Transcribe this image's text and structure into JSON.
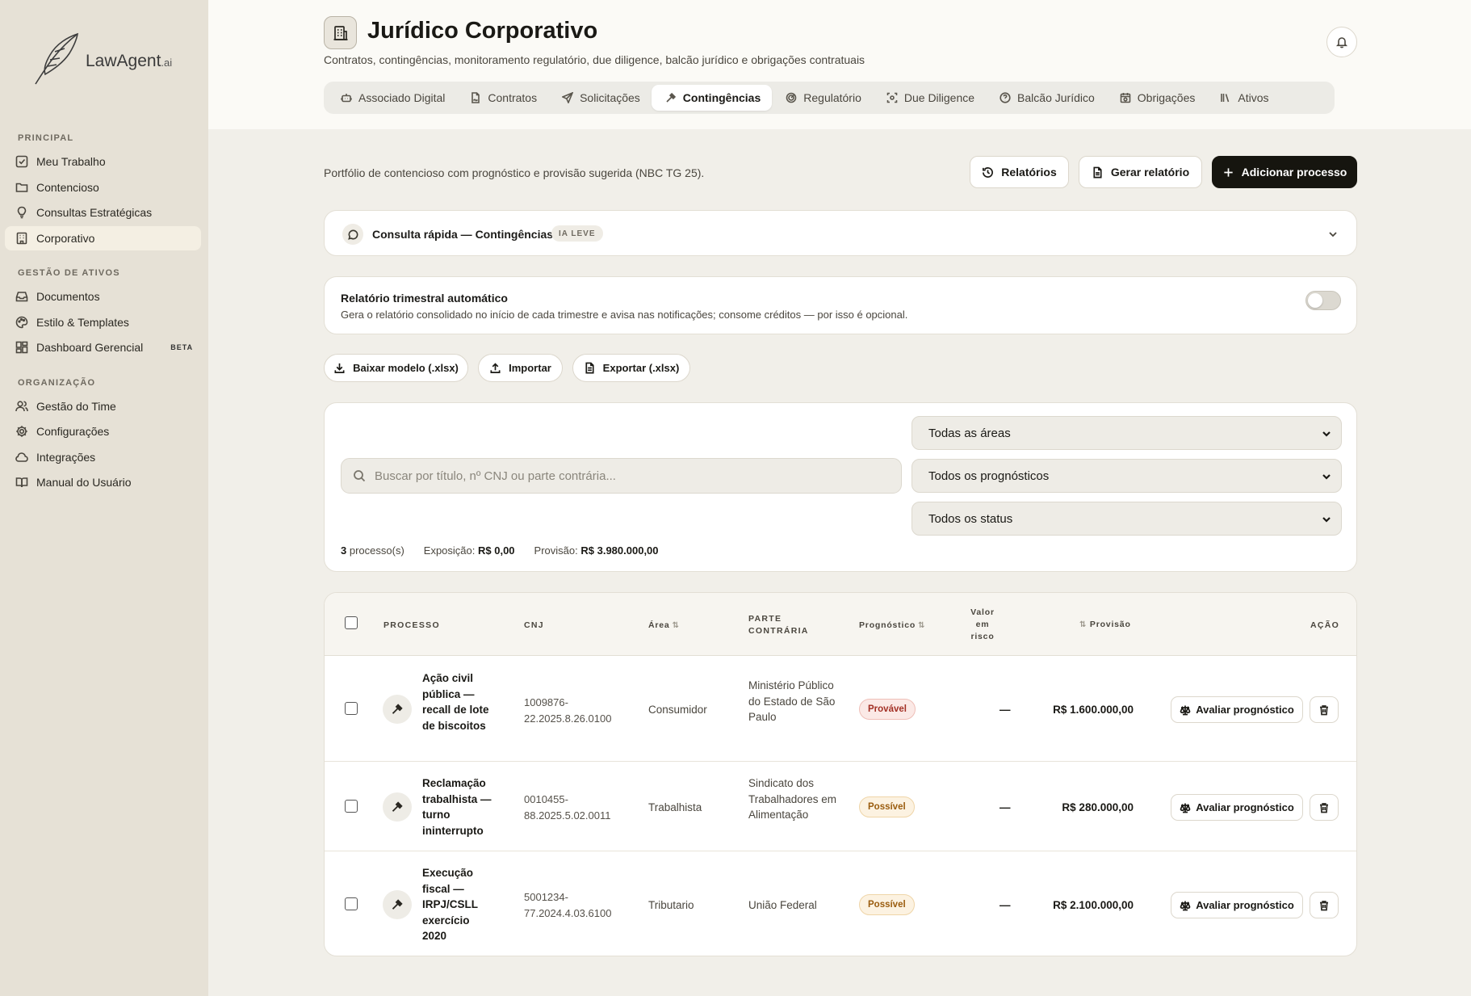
{
  "app": {
    "logo_text": "LawAgent",
    "logo_suffix": ".ai"
  },
  "sidebar": {
    "sections": [
      {
        "title": "PRINCIPAL",
        "items": [
          "Meu Trabalho",
          "Contencioso",
          "Consultas Estratégicas",
          "Corporativo"
        ]
      },
      {
        "title": "GESTÃO DE ATIVOS",
        "items": [
          "Documentos",
          "Estilo & Templates",
          "Dashboard Gerencial"
        ]
      },
      {
        "title": "ORGANIZAÇÃO",
        "items": [
          "Gestão do Time",
          "Configurações",
          "Integrações",
          "Manual do Usuário"
        ]
      }
    ],
    "beta_badge": "BETA",
    "active_item": "Corporativo"
  },
  "header": {
    "title": "Jurídico Corporativo",
    "subtitle": "Contratos, contingências, monitoramento regulatório, due diligence, balcão jurídico e obrigações contratuais",
    "tabs": [
      {
        "label": "Associado Digital",
        "icon": "robot-icon"
      },
      {
        "label": "Contratos",
        "icon": "file-signature-icon"
      },
      {
        "label": "Solicitações",
        "icon": "send-icon"
      },
      {
        "label": "Contingências",
        "icon": "gavel-icon",
        "active": true
      },
      {
        "label": "Regulatório",
        "icon": "radar-icon"
      },
      {
        "label": "Due Diligence",
        "icon": "scan-icon"
      },
      {
        "label": "Balcão Jurídico",
        "icon": "help-circle-icon"
      },
      {
        "label": "Obrigações",
        "icon": "calendar-clock-icon"
      },
      {
        "label": "Ativos",
        "icon": "library-icon"
      }
    ]
  },
  "main": {
    "description": "Portfólio de contencioso com prognóstico e provisão sugerida (NBC TG 25).",
    "buttons": {
      "relatorios": "Relatórios",
      "gerar_relatorio": "Gerar relatório",
      "adicionar_processo": "Adicionar processo"
    },
    "consulta": {
      "title": "Consulta rápida — Contingências",
      "badge": "IA LEVE"
    },
    "relatorio_auto": {
      "title": "Relatório trimestral automático",
      "description": "Gera o relatório consolidado no início de cada trimestre e avisa nas notificações; consome créditos — por isso é opcional.",
      "enabled": false
    },
    "io_buttons": {
      "baixar": "Baixar modelo (.xlsx)",
      "importar": "Importar",
      "exportar": "Exportar (.xlsx)"
    },
    "filters": {
      "search_placeholder": "Buscar por título, nº CNJ ou parte contrária...",
      "area": "Todas as áreas",
      "prognostico": "Todos os prognósticos",
      "status": "Todos os status"
    },
    "summary": {
      "count": "3",
      "count_label": "processo(s)",
      "exposicao_label": "Exposição:",
      "exposicao": "R$ 0,00",
      "provisao_label": "Provisão:",
      "provisao": "R$ 3.980.000,00"
    }
  },
  "table": {
    "headers": {
      "processo": "PROCESSO",
      "cnj": "CNJ",
      "area": "Área",
      "parte": "PARTE CONTRÁRIA",
      "prognostico": "Prognóstico",
      "valor_em_risco": "Valor em risco",
      "provisao": "Provisão",
      "acao": "AÇÃO"
    },
    "action_label": "Avaliar prognóstico",
    "rows": [
      {
        "title": "Ação civil pública — recall de lote de biscoitos",
        "cnj": "1009876-22.2025.8.26.0100",
        "area": "Consumidor",
        "parte": "Ministério Público do Estado de São Paulo",
        "prognostico": "Provável",
        "valor": "—",
        "provisao": "R$ 1.600.000,00"
      },
      {
        "title": "Reclamação trabalhista — turno ininterrupto",
        "cnj": "0010455-88.2025.5.02.0011",
        "area": "Trabalhista",
        "parte": "Sindicato dos Trabalhadores em Alimentação",
        "prognostico": "Possível",
        "valor": "—",
        "provisao": "R$ 280.000,00"
      },
      {
        "title": "Execução fiscal — IRPJ/CSLL exercício 2020",
        "cnj": "5001234-77.2024.4.03.6100",
        "area": "Tributario",
        "parte": "União Federal",
        "prognostico": "Possível",
        "valor": "—",
        "provisao": "R$ 2.100.000,00"
      }
    ]
  }
}
